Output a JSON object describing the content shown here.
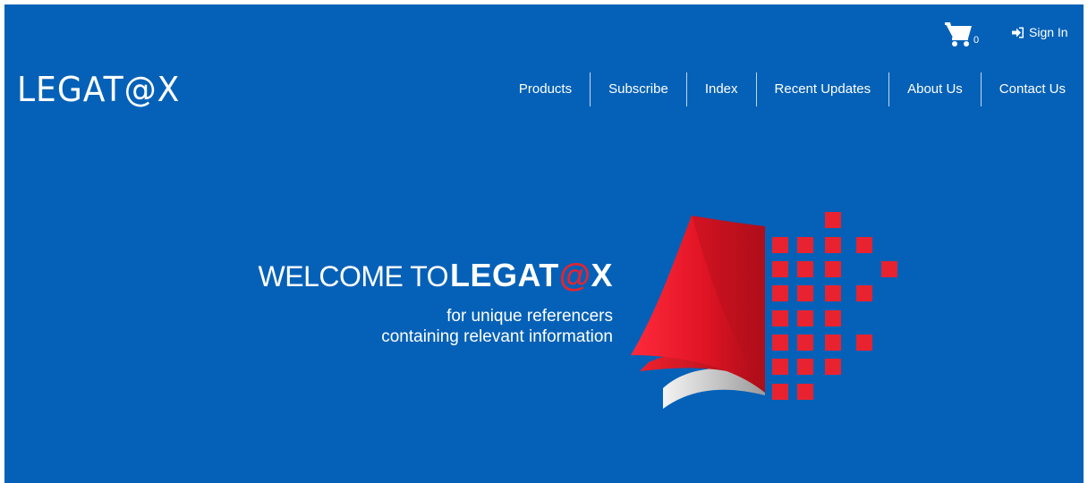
{
  "header": {
    "cart": {
      "icon": "cart-icon",
      "count": "0"
    },
    "signin": {
      "icon": "sign-in-icon",
      "label": "Sign In"
    },
    "logo": "LEGAT@X",
    "nav": [
      {
        "label": "Products"
      },
      {
        "label": "Subscribe"
      },
      {
        "label": "Index"
      },
      {
        "label": "Recent Updates"
      },
      {
        "label": "About Us"
      },
      {
        "label": "Contact Us"
      }
    ]
  },
  "hero": {
    "welcome": "WELCOME TO",
    "brand_pre": "LEGAT",
    "brand_at": "@",
    "brand_post": "X",
    "tagline_line1": "for unique referencers",
    "tagline_line2": "containing relevant information",
    "graphic": "red-book-pixel-graphic"
  },
  "colors": {
    "background": "#0561b7",
    "accent_red": "#e8232f",
    "text": "#ffffff"
  }
}
